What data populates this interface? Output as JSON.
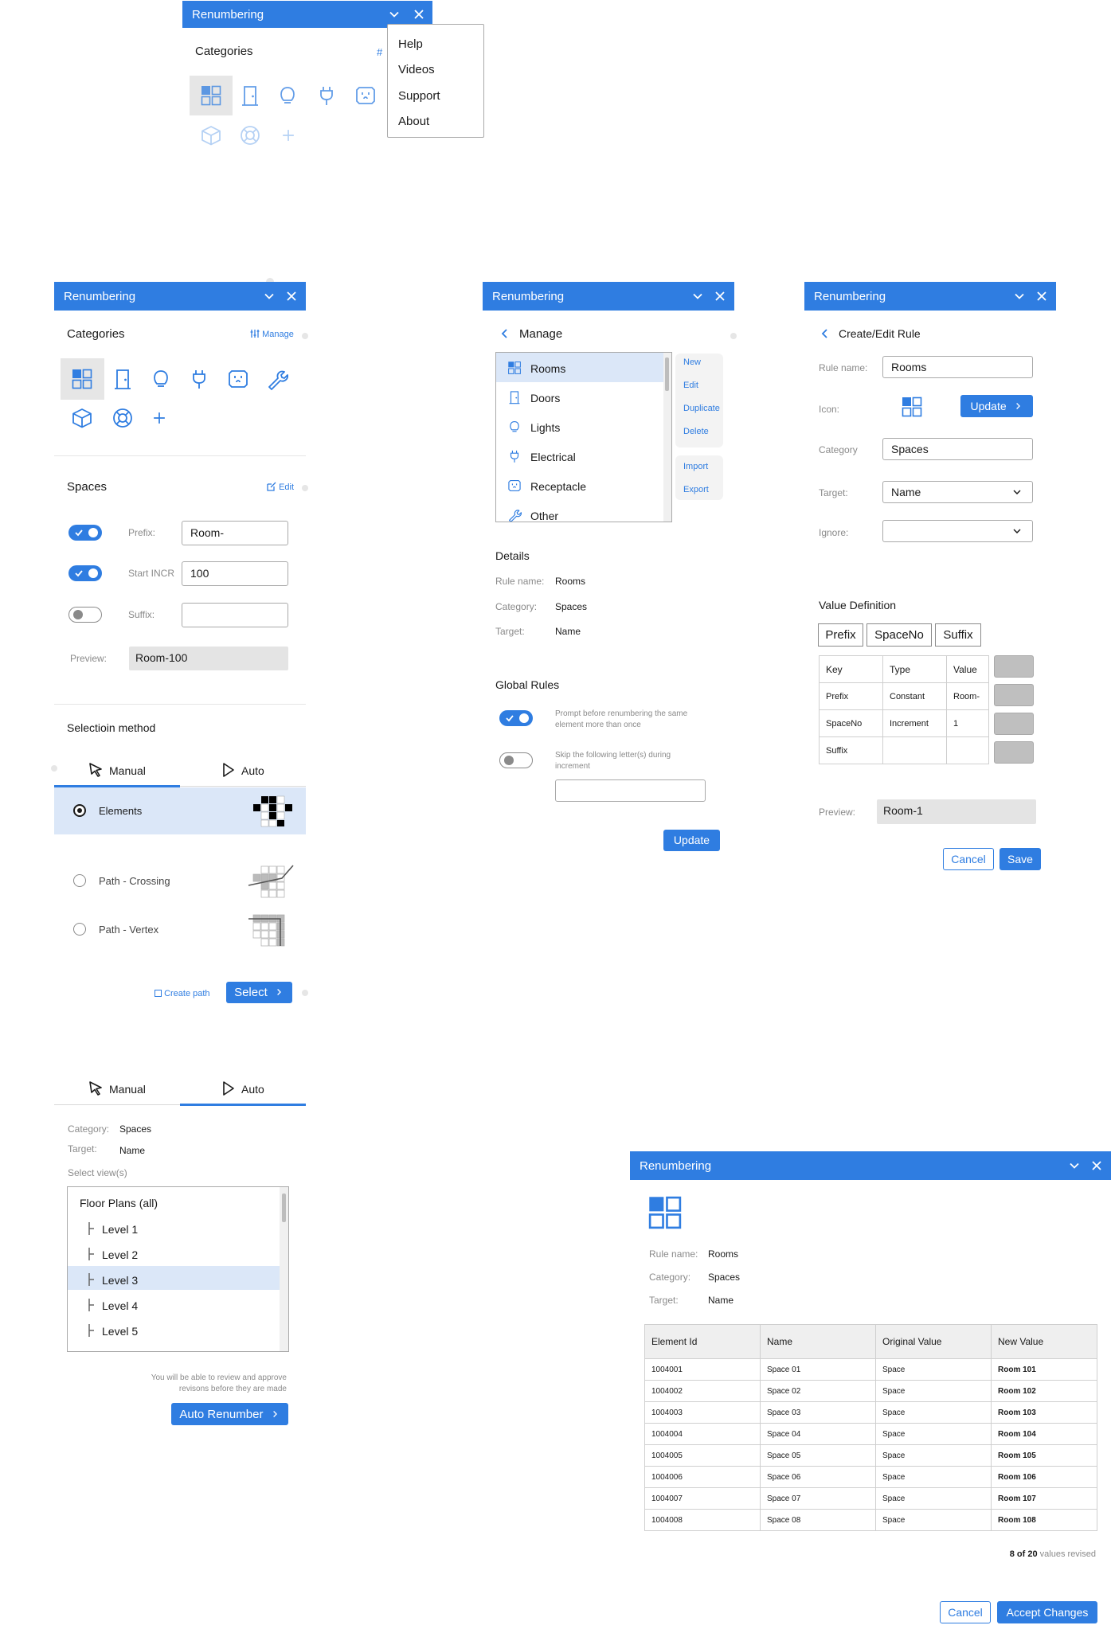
{
  "app_title": "Renumbering",
  "panel1": {
    "categories_label": "Categories",
    "manage_glyph": "#",
    "menu": [
      "Help",
      "Videos",
      "Support",
      "About"
    ]
  },
  "panel2": {
    "categories_label": "Categories",
    "manage_link": "Manage",
    "spaces_label": "Spaces",
    "edit_link": "Edit",
    "prefix_label": "Prefix:",
    "prefix_value": "Room-",
    "start_label": "Start INCR",
    "start_value": "100",
    "suffix_label": "Suffix:",
    "suffix_value": "",
    "preview_label": "Preview:",
    "preview_value": "Room-100",
    "selection_label": "Selectioin method",
    "tab_manual": "Manual",
    "tab_auto": "Auto",
    "methods": [
      {
        "label": "Elements",
        "selected": true
      },
      {
        "label": "Path - Crossing",
        "selected": false
      },
      {
        "label": "Path - Vertex",
        "selected": false
      }
    ],
    "create_path": "Create path",
    "select_button": "Select"
  },
  "panel3": {
    "back_title": "Manage",
    "items": [
      "Rooms",
      "Doors",
      "Lights",
      "Electrical",
      "Receptacle",
      "Other"
    ],
    "actions": [
      "New",
      "Edit",
      "Duplicate",
      "Delete"
    ],
    "actions2": [
      "Import",
      "Export"
    ],
    "details_label": "Details",
    "rule_name_label": "Rule name:",
    "rule_name_value": "Rooms",
    "category_label": "Category:",
    "category_value": "Spaces",
    "target_label": "Target:",
    "target_value": "Name",
    "global_label": "Global Rules",
    "rule1": "Prompt before renumbering the same element more than once",
    "rule2": "Skip the following letter(s) during increment",
    "update_button": "Update"
  },
  "panel4": {
    "back_title": "Create/Edit Rule",
    "rule_name_label": "Rule name:",
    "rule_name_value": "Rooms",
    "icon_label": "Icon:",
    "update_button": "Update",
    "category_label": "Category",
    "category_value": "Spaces",
    "target_label": "Target:",
    "target_value": "Name",
    "ignore_label": "Ignore:",
    "ignore_value": "",
    "value_def_label": "Value Definition",
    "chips": [
      "Prefix",
      "SpaceNo",
      "Suffix"
    ],
    "table_headers": [
      "Key",
      "Type",
      "Value"
    ],
    "table_rows": [
      [
        "Prefix",
        "Constant",
        "Room-"
      ],
      [
        "SpaceNo",
        "Increment",
        "1"
      ],
      [
        "Suffix",
        "",
        ""
      ]
    ],
    "preview_label": "Preview:",
    "preview_value": "Room-1",
    "cancel_button": "Cancel",
    "save_button": "Save"
  },
  "panel5": {
    "tab_manual": "Manual",
    "tab_auto": "Auto",
    "category_label": "Category:",
    "category_value": "Spaces",
    "target_label": "Target:",
    "target_value": "Name",
    "select_views_label": "Select view(s)",
    "tree_root": "Floor Plans (all)",
    "levels": [
      "Level 1",
      "Level 2",
      "Level 3",
      "Level 4",
      "Level 5"
    ],
    "note": "You will be able to review and approve revisons before they are made",
    "auto_button": "Auto Renumber"
  },
  "panel6": {
    "rule_name_label": "Rule name:",
    "rule_name_value": "Rooms",
    "category_label": "Category:",
    "category_value": "Spaces",
    "target_label": "Target:",
    "target_value": "Name",
    "headers": [
      "Element Id",
      "Name",
      "Original Value",
      "New Value"
    ],
    "rows": [
      [
        "1004001",
        "Space 01",
        "Space",
        "Room 101"
      ],
      [
        "1004002",
        "Space 02",
        "Space",
        "Room 102"
      ],
      [
        "1004003",
        "Space 03",
        "Space",
        "Room 103"
      ],
      [
        "1004004",
        "Space 04",
        "Space",
        "Room 104"
      ],
      [
        "1004005",
        "Space 05",
        "Space",
        "Room 105"
      ],
      [
        "1004006",
        "Space 06",
        "Space",
        "Room 106"
      ],
      [
        "1004007",
        "Space 07",
        "Space",
        "Room 107"
      ],
      [
        "1004008",
        "Space 08",
        "Space",
        "Room 108"
      ]
    ],
    "count_bold": "8 of 20",
    "count_rest": "values revised",
    "cancel_button": "Cancel",
    "accept_button": "Accept Changes"
  }
}
